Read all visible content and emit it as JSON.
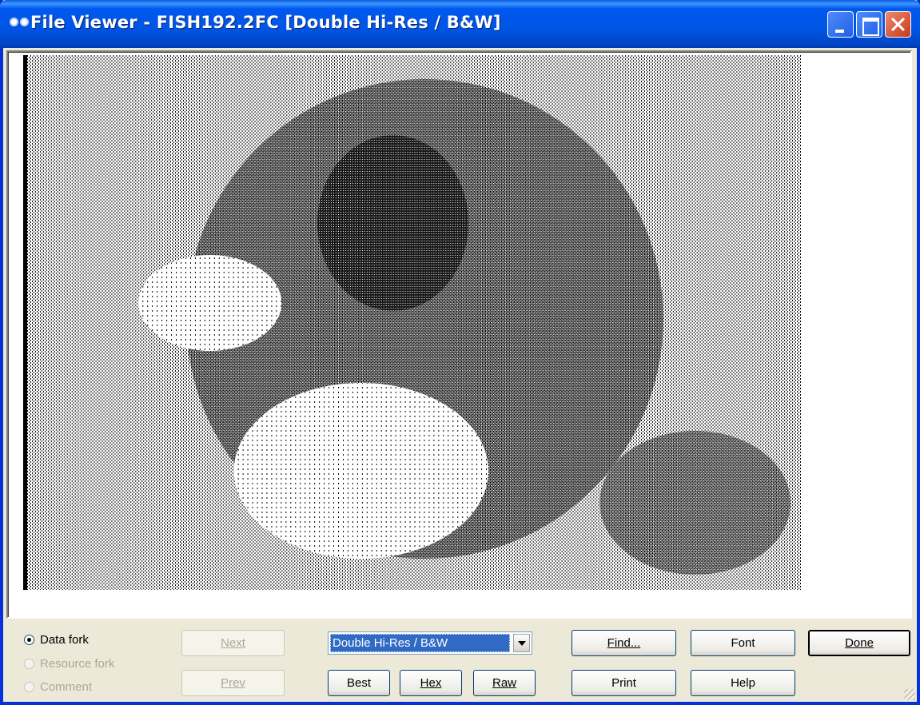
{
  "window": {
    "title": "File Viewer - FISH192.2FC [Double Hi-Res / B&W]"
  },
  "viewer": {
    "image_description_icon": "dithered-monochrome-picture"
  },
  "fork_options": [
    {
      "label": "Data fork",
      "checked": true,
      "enabled": true
    },
    {
      "label": "Resource fork",
      "checked": false,
      "enabled": false
    },
    {
      "label": "Comment",
      "checked": false,
      "enabled": false
    }
  ],
  "buttons": {
    "next": "Next",
    "prev": "Prev",
    "best": "Best",
    "hex": "Hex",
    "raw": "Raw",
    "find": "Find...",
    "print": "Print",
    "font": "Font",
    "help": "Help",
    "done": "Done"
  },
  "format_select": {
    "selected": "Double Hi-Res / B&W"
  },
  "colors": {
    "title_bar": "#0055e5",
    "selection": "#316ac5",
    "dialog_bg": "#ece9d8"
  }
}
